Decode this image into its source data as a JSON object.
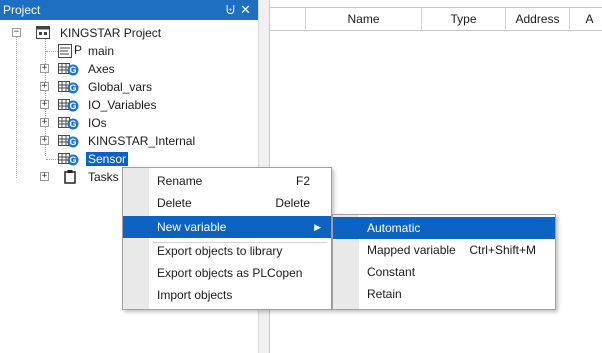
{
  "panel": {
    "title": "Project",
    "pin_glyph": "⨄",
    "close_glyph": "✕"
  },
  "tree": {
    "root": {
      "label": "KINGSTAR Project",
      "expander": "−"
    },
    "items": [
      {
        "label": "main",
        "icon": "program-icon",
        "icon_glyph": "P"
      },
      {
        "label": "Axes",
        "icon": "gvl-icon",
        "expander": "+"
      },
      {
        "label": "Global_vars",
        "icon": "gvl-icon",
        "expander": "+"
      },
      {
        "label": "IO_Variables",
        "icon": "gvl-icon",
        "expander": "+"
      },
      {
        "label": "IOs",
        "icon": "gvl-icon",
        "expander": "+"
      },
      {
        "label": "KINGSTAR_Internal",
        "icon": "gvl-icon",
        "expander": "+"
      },
      {
        "label": "Sensor",
        "icon": "gvl-icon",
        "selected": true
      },
      {
        "label": "Tasks",
        "icon": "task-icon",
        "expander": "+"
      }
    ]
  },
  "table": {
    "columns": [
      "",
      "Name",
      "Type",
      "Address",
      "A"
    ]
  },
  "context_menu": {
    "items": [
      {
        "label": "Rename",
        "shortcut": "F2"
      },
      {
        "label": "Delete",
        "shortcut": "Delete"
      },
      {
        "label": "New variable",
        "arrow": "▶",
        "highlighted": true
      },
      {
        "label": "Export objects to library"
      },
      {
        "label": "Export objects as PLCopen"
      },
      {
        "label": "Import objects"
      }
    ]
  },
  "submenu": {
    "items": [
      {
        "label": "Automatic",
        "highlighted": true
      },
      {
        "label": "Mapped variable",
        "shortcut": "Ctrl+Shift+M"
      },
      {
        "label": "Constant"
      },
      {
        "label": "Retain"
      }
    ]
  },
  "colors": {
    "accent": "#0d63c4",
    "header": "#1d6fc2",
    "gvl_badge": "#1a73d1",
    "gvl_grid": "#4a4a4a"
  }
}
